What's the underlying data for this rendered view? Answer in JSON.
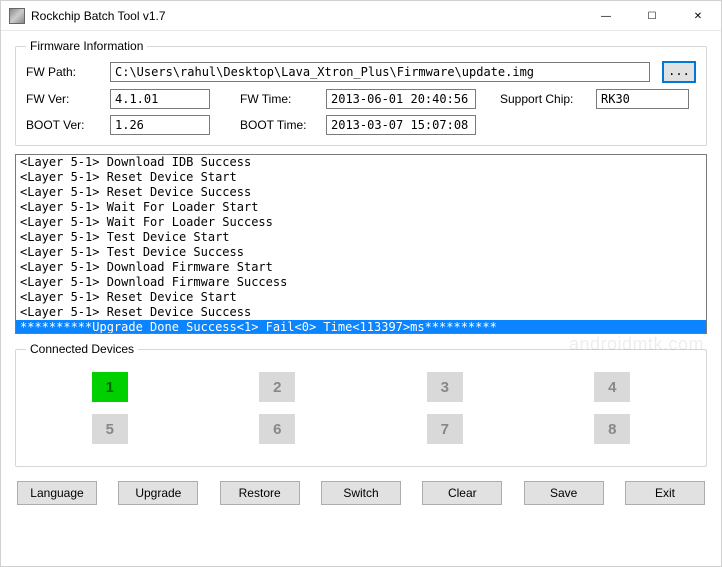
{
  "window": {
    "title": "Rockchip Batch Tool v1.7",
    "minimize": "—",
    "maximize": "☐",
    "close": "✕"
  },
  "firmware": {
    "legend": "Firmware Information",
    "path_label": "FW Path:",
    "path_value": "C:\\Users\\rahul\\Desktop\\Lava_Xtron_Plus\\Firmware\\update.img",
    "browse": "...",
    "ver_label": "FW Ver:",
    "ver_value": "4.1.01",
    "time_label": "FW Time:",
    "time_value": "2013-06-01 20:40:56",
    "chip_label": "Support Chip:",
    "chip_value": "RK30",
    "boot_ver_label": "BOOT Ver:",
    "boot_ver_value": "1.26",
    "boot_time_label": "BOOT Time:",
    "boot_time_value": "2013-03-07 15:07:08"
  },
  "log": {
    "lines": [
      "<Layer 5-1> Download IDB Success",
      "<Layer 5-1> Reset Device Start",
      "<Layer 5-1> Reset Device Success",
      "<Layer 5-1> Wait For Loader Start",
      "<Layer 5-1> Wait For Loader Success",
      "<Layer 5-1> Test Device Start",
      "<Layer 5-1> Test Device Success",
      "<Layer 5-1> Download Firmware Start",
      "<Layer 5-1> Download Firmware Success",
      "<Layer 5-1> Reset Device Start",
      "<Layer 5-1> Reset Device Success"
    ],
    "selected": "**********Upgrade Done Success<1> Fail<0> Time<113397>ms**********"
  },
  "devices": {
    "legend": "Connected Devices",
    "slots": [
      "1",
      "2",
      "3",
      "4",
      "5",
      "6",
      "7",
      "8"
    ],
    "active_index": 0
  },
  "buttons": {
    "language": "Language",
    "upgrade": "Upgrade",
    "restore": "Restore",
    "switch": "Switch",
    "clear": "Clear",
    "save": "Save",
    "exit": "Exit"
  },
  "watermark": "androidmtk.com"
}
